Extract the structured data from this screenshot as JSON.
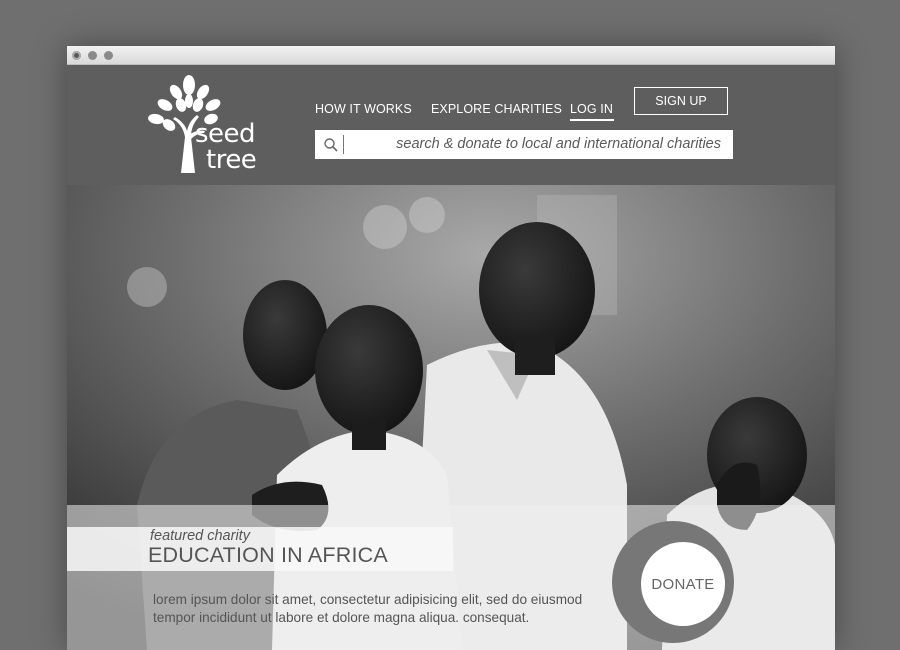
{
  "brand": {
    "line1": "seed",
    "line2": "tree"
  },
  "nav": {
    "how_it_works": "HOW IT WORKS",
    "explore": "EXPLORE CHARITIES",
    "login": "LOG IN",
    "signup": "SIGN UP"
  },
  "search": {
    "placeholder": "search & donate to local and international charities"
  },
  "featured": {
    "kicker": "featured charity",
    "title": "EDUCATION IN AFRICA",
    "description": "lorem ipsum dolor sit amet, consectetur adipisicing elit, sed do eiusmod tempor incididunt ut labore et dolore magna aliqua. consequat."
  },
  "donate": {
    "label": "DONATE"
  },
  "icons": {
    "search": "search-icon",
    "logo": "tree-icon"
  },
  "colors": {
    "header_bg": "#5e5e5e",
    "accent": "#ffffff",
    "text_muted": "#555555"
  }
}
